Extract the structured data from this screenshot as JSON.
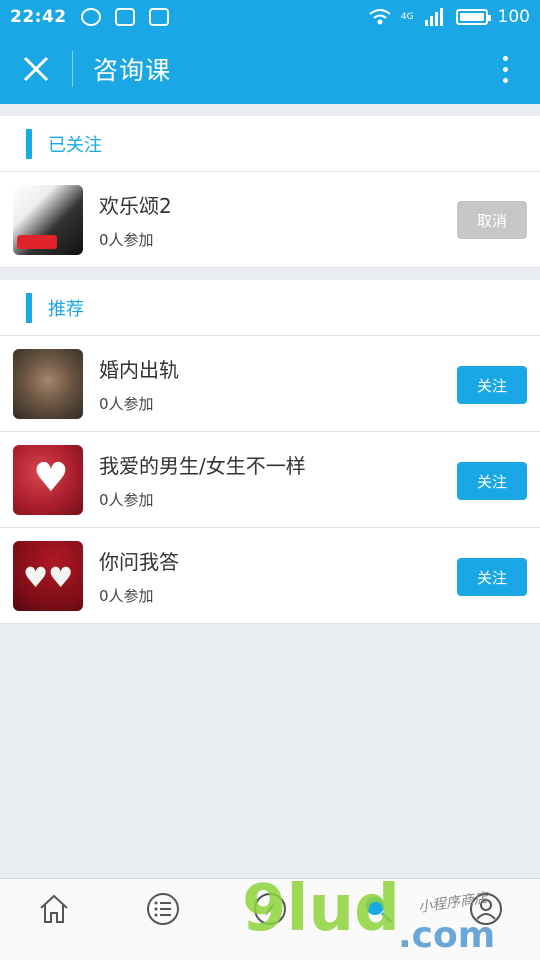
{
  "status_bar": {
    "time": "22:42",
    "signal_label": "4G",
    "battery": "100"
  },
  "app_bar": {
    "title": "咨询课"
  },
  "sections": [
    {
      "title": "已关注",
      "items": [
        {
          "title": "欢乐颂2",
          "participants": "0人参加",
          "action": "取消"
        }
      ]
    },
    {
      "title": "推荐",
      "items": [
        {
          "title": "婚内出轨",
          "participants": "0人参加",
          "action": "关注"
        },
        {
          "title": "我爱的男生/女生不一样",
          "participants": "0人参加",
          "action": "关注"
        },
        {
          "title": "你问我答",
          "participants": "0人参加",
          "action": "关注"
        }
      ]
    }
  ],
  "bottom_nav": [
    {
      "icon": "home-icon"
    },
    {
      "icon": "list-icon"
    },
    {
      "icon": "compass-icon"
    },
    {
      "icon": "search-icon"
    },
    {
      "icon": "profile-icon"
    }
  ],
  "watermark": {
    "main": "9lud",
    "tld": ".com",
    "sign": "小程序商店"
  },
  "colors": {
    "accent": "#1aa7e6",
    "disabled_button": "#c6c6c6",
    "background": "#e9edf2"
  }
}
